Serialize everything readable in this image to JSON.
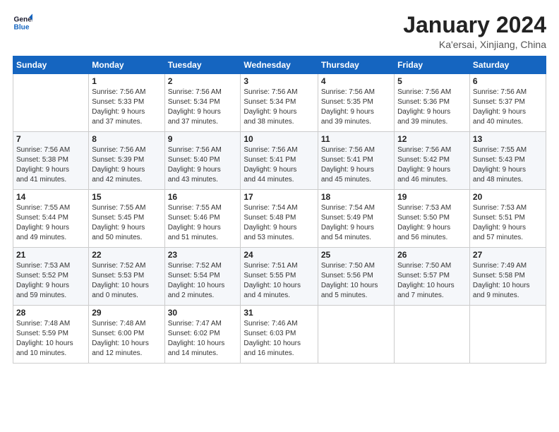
{
  "logo": {
    "line1": "General",
    "line2": "Blue"
  },
  "title": "January 2024",
  "subtitle": "Ka'ersai, Xinjiang, China",
  "weekdays": [
    "Sunday",
    "Monday",
    "Tuesday",
    "Wednesday",
    "Thursday",
    "Friday",
    "Saturday"
  ],
  "weeks": [
    [
      {
        "day": "",
        "info": ""
      },
      {
        "day": "1",
        "info": "Sunrise: 7:56 AM\nSunset: 5:33 PM\nDaylight: 9 hours\nand 37 minutes."
      },
      {
        "day": "2",
        "info": "Sunrise: 7:56 AM\nSunset: 5:34 PM\nDaylight: 9 hours\nand 37 minutes."
      },
      {
        "day": "3",
        "info": "Sunrise: 7:56 AM\nSunset: 5:34 PM\nDaylight: 9 hours\nand 38 minutes."
      },
      {
        "day": "4",
        "info": "Sunrise: 7:56 AM\nSunset: 5:35 PM\nDaylight: 9 hours\nand 39 minutes."
      },
      {
        "day": "5",
        "info": "Sunrise: 7:56 AM\nSunset: 5:36 PM\nDaylight: 9 hours\nand 39 minutes."
      },
      {
        "day": "6",
        "info": "Sunrise: 7:56 AM\nSunset: 5:37 PM\nDaylight: 9 hours\nand 40 minutes."
      }
    ],
    [
      {
        "day": "7",
        "info": "Sunrise: 7:56 AM\nSunset: 5:38 PM\nDaylight: 9 hours\nand 41 minutes."
      },
      {
        "day": "8",
        "info": "Sunrise: 7:56 AM\nSunset: 5:39 PM\nDaylight: 9 hours\nand 42 minutes."
      },
      {
        "day": "9",
        "info": "Sunrise: 7:56 AM\nSunset: 5:40 PM\nDaylight: 9 hours\nand 43 minutes."
      },
      {
        "day": "10",
        "info": "Sunrise: 7:56 AM\nSunset: 5:41 PM\nDaylight: 9 hours\nand 44 minutes."
      },
      {
        "day": "11",
        "info": "Sunrise: 7:56 AM\nSunset: 5:41 PM\nDaylight: 9 hours\nand 45 minutes."
      },
      {
        "day": "12",
        "info": "Sunrise: 7:56 AM\nSunset: 5:42 PM\nDaylight: 9 hours\nand 46 minutes."
      },
      {
        "day": "13",
        "info": "Sunrise: 7:55 AM\nSunset: 5:43 PM\nDaylight: 9 hours\nand 48 minutes."
      }
    ],
    [
      {
        "day": "14",
        "info": "Sunrise: 7:55 AM\nSunset: 5:44 PM\nDaylight: 9 hours\nand 49 minutes."
      },
      {
        "day": "15",
        "info": "Sunrise: 7:55 AM\nSunset: 5:45 PM\nDaylight: 9 hours\nand 50 minutes."
      },
      {
        "day": "16",
        "info": "Sunrise: 7:55 AM\nSunset: 5:46 PM\nDaylight: 9 hours\nand 51 minutes."
      },
      {
        "day": "17",
        "info": "Sunrise: 7:54 AM\nSunset: 5:48 PM\nDaylight: 9 hours\nand 53 minutes."
      },
      {
        "day": "18",
        "info": "Sunrise: 7:54 AM\nSunset: 5:49 PM\nDaylight: 9 hours\nand 54 minutes."
      },
      {
        "day": "19",
        "info": "Sunrise: 7:53 AM\nSunset: 5:50 PM\nDaylight: 9 hours\nand 56 minutes."
      },
      {
        "day": "20",
        "info": "Sunrise: 7:53 AM\nSunset: 5:51 PM\nDaylight: 9 hours\nand 57 minutes."
      }
    ],
    [
      {
        "day": "21",
        "info": "Sunrise: 7:53 AM\nSunset: 5:52 PM\nDaylight: 9 hours\nand 59 minutes."
      },
      {
        "day": "22",
        "info": "Sunrise: 7:52 AM\nSunset: 5:53 PM\nDaylight: 10 hours\nand 0 minutes."
      },
      {
        "day": "23",
        "info": "Sunrise: 7:52 AM\nSunset: 5:54 PM\nDaylight: 10 hours\nand 2 minutes."
      },
      {
        "day": "24",
        "info": "Sunrise: 7:51 AM\nSunset: 5:55 PM\nDaylight: 10 hours\nand 4 minutes."
      },
      {
        "day": "25",
        "info": "Sunrise: 7:50 AM\nSunset: 5:56 PM\nDaylight: 10 hours\nand 5 minutes."
      },
      {
        "day": "26",
        "info": "Sunrise: 7:50 AM\nSunset: 5:57 PM\nDaylight: 10 hours\nand 7 minutes."
      },
      {
        "day": "27",
        "info": "Sunrise: 7:49 AM\nSunset: 5:58 PM\nDaylight: 10 hours\nand 9 minutes."
      }
    ],
    [
      {
        "day": "28",
        "info": "Sunrise: 7:48 AM\nSunset: 5:59 PM\nDaylight: 10 hours\nand 10 minutes."
      },
      {
        "day": "29",
        "info": "Sunrise: 7:48 AM\nSunset: 6:00 PM\nDaylight: 10 hours\nand 12 minutes."
      },
      {
        "day": "30",
        "info": "Sunrise: 7:47 AM\nSunset: 6:02 PM\nDaylight: 10 hours\nand 14 minutes."
      },
      {
        "day": "31",
        "info": "Sunrise: 7:46 AM\nSunset: 6:03 PM\nDaylight: 10 hours\nand 16 minutes."
      },
      {
        "day": "",
        "info": ""
      },
      {
        "day": "",
        "info": ""
      },
      {
        "day": "",
        "info": ""
      }
    ]
  ]
}
